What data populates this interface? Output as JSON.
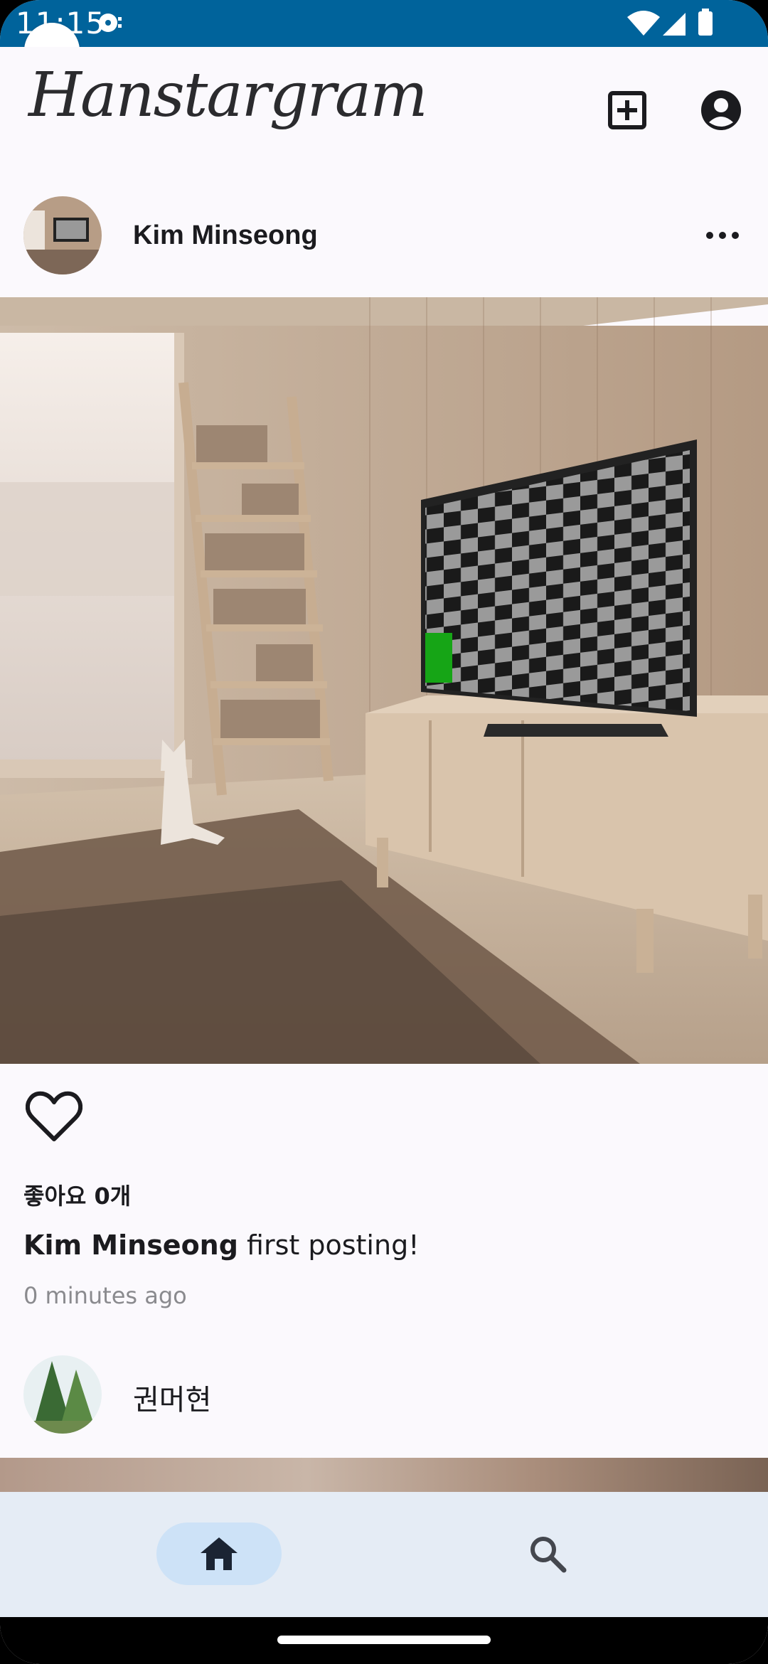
{
  "status_bar": {
    "time": "11:15",
    "icons": [
      "media-icon",
      "wifi-icon",
      "signal-icon",
      "battery-icon"
    ]
  },
  "app_bar": {
    "logo_text": "Hanstargram",
    "actions": [
      "add-post-icon",
      "account-icon"
    ]
  },
  "post": {
    "author": "Kim Minseong",
    "avatar": "room-thumbnail",
    "more_icon": "more-horizontal-icon",
    "image": "room-with-tv-and-cat",
    "like_icon": "heart-outline-icon",
    "likes_text": "좋아요 0개",
    "caption_author": "Kim Minseong",
    "caption_text": " first posting!",
    "timestamp": "0 minutes ago"
  },
  "next_post": {
    "author": "권머현",
    "avatar": "trees-thumbnail"
  },
  "bottom_nav": {
    "items": [
      {
        "icon": "home-icon",
        "active": true
      },
      {
        "icon": "search-icon",
        "active": false
      }
    ]
  },
  "colors": {
    "status_bar": "#00639b",
    "background": "#fbf9fd",
    "nav_background": "#e5ecf5",
    "nav_active": "#cde2f7",
    "text_primary": "#1b1b1f",
    "text_secondary": "#8a8a8e"
  }
}
